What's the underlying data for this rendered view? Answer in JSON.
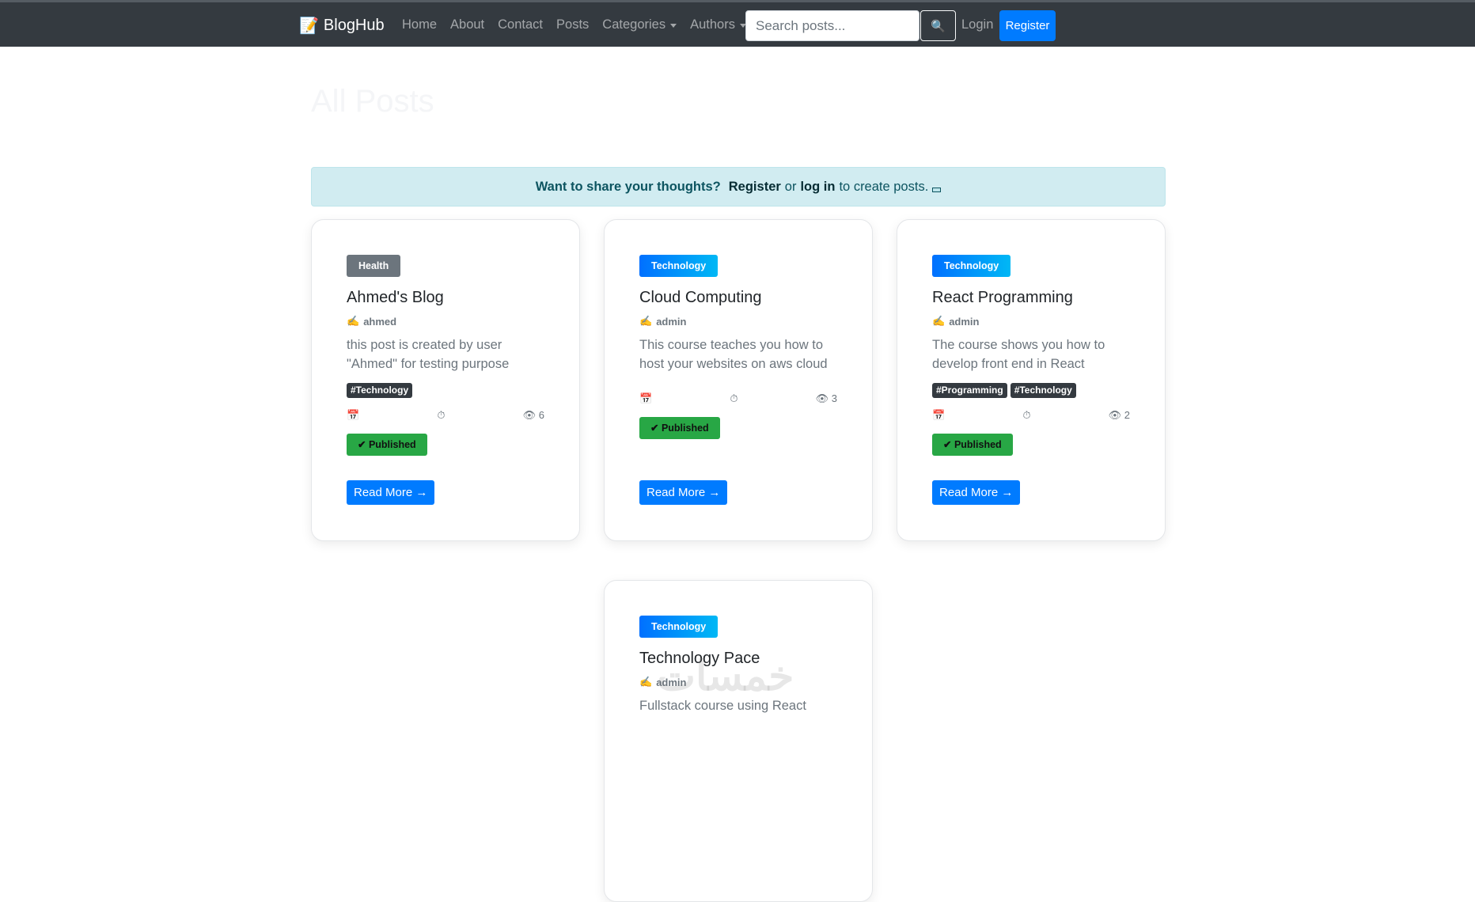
{
  "navbar": {
    "brand_icon": "📝",
    "brand": "BlogHub",
    "links": [
      {
        "label": "Home"
      },
      {
        "label": "About"
      },
      {
        "label": "Contact"
      },
      {
        "label": "Posts"
      },
      {
        "label": "Categories",
        "dropdown": true
      },
      {
        "label": "Authors",
        "dropdown": true
      }
    ],
    "search_placeholder": "Search posts...",
    "search_icon": "🔍",
    "login": "Login",
    "register": "Register"
  },
  "page_title": "All Posts",
  "alert": {
    "lead": "Want to share your thoughts?",
    "register": "Register",
    "or": "or",
    "login": "log in",
    "tail": "to create posts."
  },
  "posts": [
    {
      "category": "Health",
      "title": "Ahmed's Blog",
      "author_icon": "✍",
      "author": "ahmed",
      "description": "this post is created by user \"Ahmed\" for testing purpose",
      "tags": [
        "#Technology"
      ],
      "calendar_icon": "📅",
      "timer_icon": "⏱",
      "views_icon": "👁",
      "views": "6",
      "status": "✔ Published",
      "read_more": "Read More →"
    },
    {
      "category": "Technology",
      "title": "Cloud Computing",
      "author_icon": "✍",
      "author": "admin",
      "description": "This course teaches you how to host your websites on aws cloud",
      "tags": [],
      "calendar_icon": "📅",
      "timer_icon": "⏱",
      "views_icon": "👁",
      "views": "3",
      "status": "✔ Published",
      "read_more": "Read More →"
    },
    {
      "category": "Technology",
      "title": "React Programming",
      "author_icon": "✍",
      "author": "admin",
      "description": "The course shows you how to develop front end in React",
      "tags": [
        "#Programming",
        "#Technology"
      ],
      "calendar_icon": "📅",
      "timer_icon": "⏱",
      "views_icon": "👁",
      "views": "2",
      "status": "✔ Published",
      "read_more": "Read More →"
    },
    {
      "category": "Technology",
      "title": "Technology Pace",
      "author_icon": "✍",
      "author": "admin",
      "description": "Fullstack course using React",
      "tags": [],
      "calendar_icon": "📅",
      "timer_icon": "⏱",
      "views_icon": "👁",
      "views": "",
      "status": "",
      "read_more": ""
    }
  ],
  "watermark": "خمسات"
}
